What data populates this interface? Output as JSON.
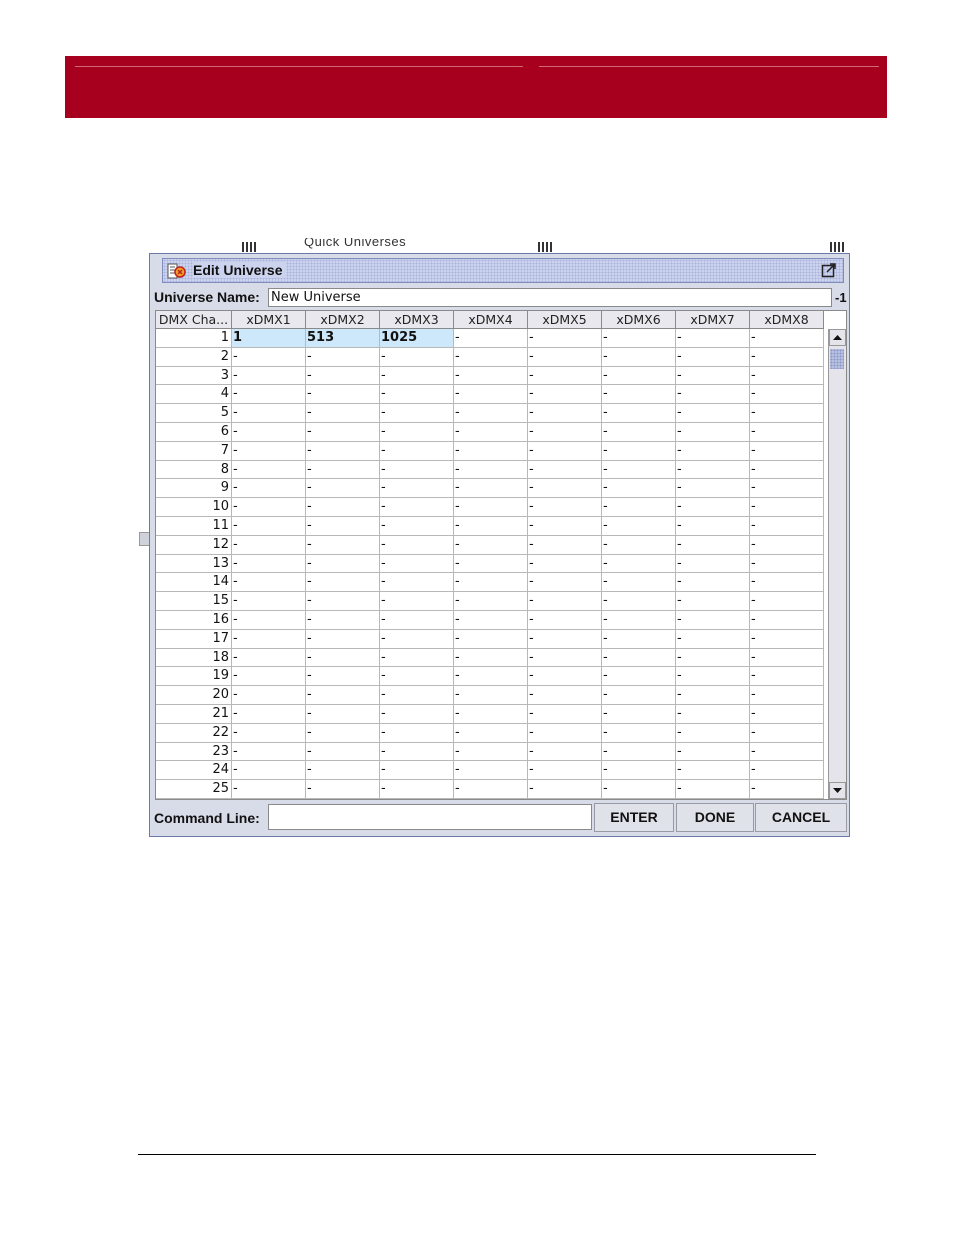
{
  "background_window": {
    "panel_label_partial": "Quick Universes"
  },
  "dialog": {
    "title": "Edit Universe",
    "universe_name_label": "Universe Name:",
    "universe_name_value": "New Universe",
    "universe_name_extra": "-1",
    "columns": [
      "DMX Cha...",
      "xDMX1",
      "xDMX2",
      "xDMX3",
      "xDMX4",
      "xDMX5",
      "xDMX6",
      "xDMX7",
      "xDMX8"
    ],
    "rows": [
      [
        "1",
        "1",
        "513",
        "1025",
        "-",
        "-",
        "-",
        "-",
        "-"
      ],
      [
        "2",
        "-",
        "-",
        "-",
        "-",
        "-",
        "-",
        "-",
        "-"
      ],
      [
        "3",
        "-",
        "-",
        "-",
        "-",
        "-",
        "-",
        "-",
        "-"
      ],
      [
        "4",
        "-",
        "-",
        "-",
        "-",
        "-",
        "-",
        "-",
        "-"
      ],
      [
        "5",
        "-",
        "-",
        "-",
        "-",
        "-",
        "-",
        "-",
        "-"
      ],
      [
        "6",
        "-",
        "-",
        "-",
        "-",
        "-",
        "-",
        "-",
        "-"
      ],
      [
        "7",
        "-",
        "-",
        "-",
        "-",
        "-",
        "-",
        "-",
        "-"
      ],
      [
        "8",
        "-",
        "-",
        "-",
        "-",
        "-",
        "-",
        "-",
        "-"
      ],
      [
        "9",
        "-",
        "-",
        "-",
        "-",
        "-",
        "-",
        "-",
        "-"
      ],
      [
        "10",
        "-",
        "-",
        "-",
        "-",
        "-",
        "-",
        "-",
        "-"
      ],
      [
        "11",
        "-",
        "-",
        "-",
        "-",
        "-",
        "-",
        "-",
        "-"
      ],
      [
        "12",
        "-",
        "-",
        "-",
        "-",
        "-",
        "-",
        "-",
        "-"
      ],
      [
        "13",
        "-",
        "-",
        "-",
        "-",
        "-",
        "-",
        "-",
        "-"
      ],
      [
        "14",
        "-",
        "-",
        "-",
        "-",
        "-",
        "-",
        "-",
        "-"
      ],
      [
        "15",
        "-",
        "-",
        "-",
        "-",
        "-",
        "-",
        "-",
        "-"
      ],
      [
        "16",
        "-",
        "-",
        "-",
        "-",
        "-",
        "-",
        "-",
        "-"
      ],
      [
        "17",
        "-",
        "-",
        "-",
        "-",
        "-",
        "-",
        "-",
        "-"
      ],
      [
        "18",
        "-",
        "-",
        "-",
        "-",
        "-",
        "-",
        "-",
        "-"
      ],
      [
        "19",
        "-",
        "-",
        "-",
        "-",
        "-",
        "-",
        "-",
        "-"
      ],
      [
        "20",
        "-",
        "-",
        "-",
        "-",
        "-",
        "-",
        "-",
        "-"
      ],
      [
        "21",
        "-",
        "-",
        "-",
        "-",
        "-",
        "-",
        "-",
        "-"
      ],
      [
        "22",
        "-",
        "-",
        "-",
        "-",
        "-",
        "-",
        "-",
        "-"
      ],
      [
        "23",
        "-",
        "-",
        "-",
        "-",
        "-",
        "-",
        "-",
        "-"
      ],
      [
        "24",
        "-",
        "-",
        "-",
        "-",
        "-",
        "-",
        "-",
        "-"
      ],
      [
        "25",
        "-",
        "-",
        "-",
        "-",
        "-",
        "-",
        "-",
        "-"
      ]
    ],
    "highlighted_row": 0,
    "highlighted_columns": [
      1,
      2,
      3
    ],
    "command_line_label": "Command Line:",
    "command_line_value": "",
    "buttons": {
      "enter": "ENTER",
      "done": "DONE",
      "cancel": "CANCEL"
    }
  },
  "colors": {
    "banner": "#a6001e",
    "selection": "#cde8fa",
    "titlebar": "#ccd3ee"
  },
  "icons": {
    "title": "universe-edit-icon",
    "maximize": "maximize-icon",
    "scroll_up": "scroll-up-arrow-icon",
    "scroll_down": "scroll-down-arrow-icon"
  }
}
